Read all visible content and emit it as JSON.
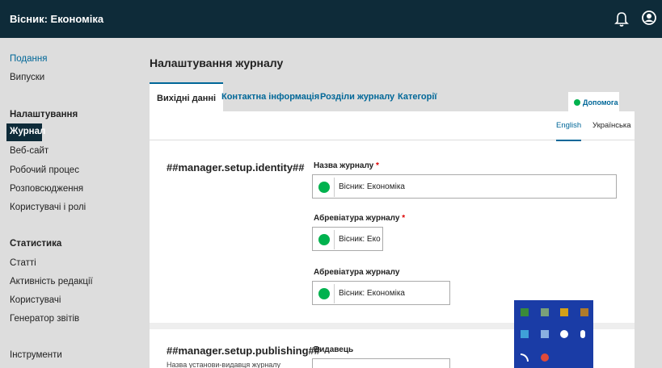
{
  "header": {
    "title": "Вісник: Економіка",
    "bell_icon": "bell-icon",
    "user_icon": "user-icon"
  },
  "sidebar": {
    "submissions": "Подання",
    "issues": "Випуски",
    "settings_heading": "Налаштування",
    "settings_items": [
      "Журнал",
      "Веб-сайт",
      "Робочий процес",
      "Розповсюдження",
      "Користувачі і ролі"
    ],
    "stats_heading": "Статистика",
    "stats_items": [
      "Статті",
      "Активність редакції",
      "Користувачі",
      "Генератор звітів"
    ],
    "tools": "Інструменти"
  },
  "page": {
    "title": "Налаштування журналу"
  },
  "tabs": [
    "Вихідні данні",
    "Контактна інформація",
    "Розділи журналу",
    "Категорії"
  ],
  "help_label": "Допомога",
  "languages": [
    "English",
    "Українська"
  ],
  "identity": {
    "section_title": "##manager.setup.identity##",
    "journal_name_label": "Назва журналу",
    "journal_name_value": "Вісник: Економіка",
    "abbreviation_label": "Абревіатура журналу",
    "abbreviation_value": "Вісник: Еко",
    "abbreviation2_label": "Абревіатура журналу",
    "abbreviation2_value": "Вісник: Економіка",
    "required_mark": "*"
  },
  "publishing": {
    "section_title": "##manager.setup.publishing##",
    "description": "Назва установи-видавця журналу",
    "publisher_label": "Видавець"
  },
  "colors": {
    "header_bg": "#0e2b39",
    "link": "#006798",
    "globe": "#00b24e",
    "tray": "#1a3ca6"
  }
}
